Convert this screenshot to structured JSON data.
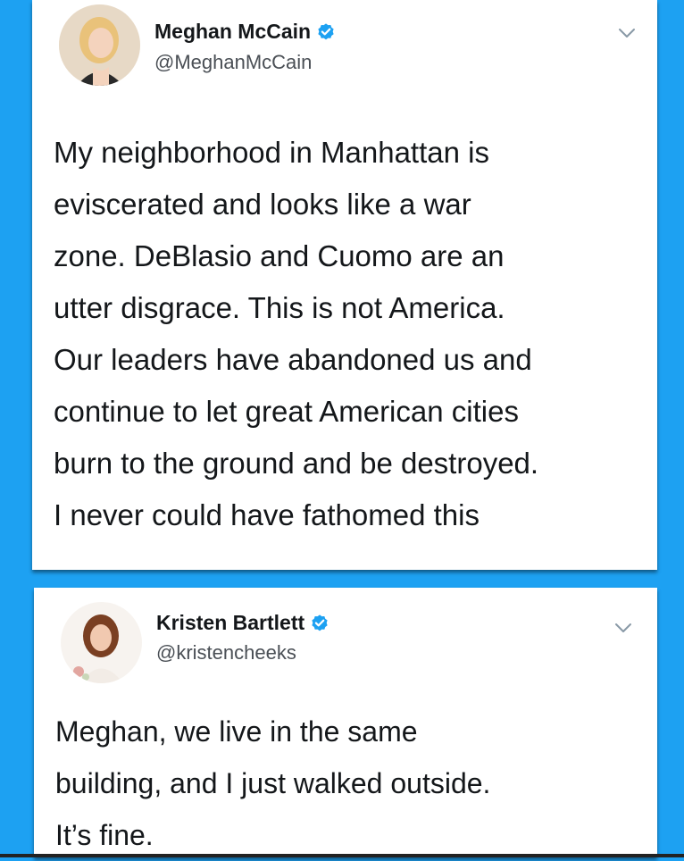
{
  "colors": {
    "background": "#1da1f2",
    "card": "#ffffff",
    "verified": "#1da1f2",
    "text": "#14171a",
    "handle": "#4a4f55"
  },
  "tweets": [
    {
      "display_name": "Meghan McCain",
      "handle": "@MeghanMcCain",
      "verified_icon": "verified-badge-icon",
      "menu_icon": "chevron-down-icon",
      "text_lines": [
        "My neighborhood in Manhattan is",
        "eviscerated and looks like a war",
        "zone. DeBlasio and Cuomo are an",
        "utter disgrace. This is not America.",
        "Our leaders have abandoned us and",
        "continue to let great American cities",
        "burn to the ground and be destroyed.",
        "I never could have fathomed this"
      ]
    },
    {
      "display_name": "Kristen Bartlett",
      "handle": "@kristencheeks",
      "verified_icon": "verified-badge-icon",
      "menu_icon": "chevron-down-icon",
      "text_lines": [
        "Meghan, we live in the same",
        "building, and I just walked outside.",
        "It’s fine."
      ]
    }
  ]
}
